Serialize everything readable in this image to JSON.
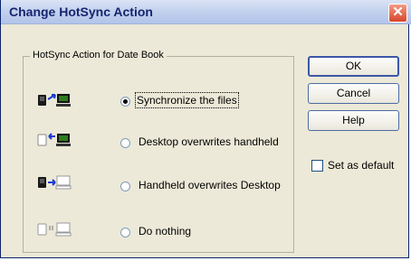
{
  "window": {
    "title": "Change HotSync Action",
    "close_glyph": "✕"
  },
  "group": {
    "label": "HotSync Action for Date Book"
  },
  "options": [
    {
      "label": "Synchronize the files",
      "checked": true,
      "icon": "sync-both-icon"
    },
    {
      "label": "Desktop overwrites handheld",
      "checked": false,
      "icon": "desktop-to-handheld-icon"
    },
    {
      "label": "Handheld overwrites Desktop",
      "checked": false,
      "icon": "handheld-to-desktop-icon"
    },
    {
      "label": "Do nothing",
      "checked": false,
      "icon": "do-nothing-icon"
    }
  ],
  "buttons": {
    "ok": "OK",
    "cancel": "Cancel",
    "help": "Help"
  },
  "set_default": {
    "label": "Set as default",
    "checked": false
  },
  "colors": {
    "arrow": "#1a3bd1",
    "device_dark": "#1a1a1a",
    "device_light": "#a8a8a8",
    "pc": "#2e7d1e"
  }
}
